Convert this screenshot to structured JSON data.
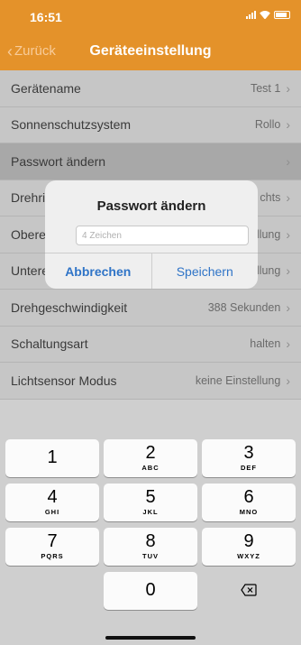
{
  "status": {
    "time": "16:51"
  },
  "nav": {
    "back_label": "Zurück",
    "title": "Geräteeinstellung"
  },
  "settings": [
    {
      "label": "Gerätename",
      "value": "Test 1"
    },
    {
      "label": "Sonnenschutzsystem",
      "value": "Rollo"
    },
    {
      "label": "Passwort ändern",
      "value": ""
    },
    {
      "label": "Drehric",
      "value": "chts"
    },
    {
      "label": "Obere",
      "value": "llung"
    },
    {
      "label": "Untere Endlage",
      "value": "keine Einstellung"
    },
    {
      "label": "Drehgeschwindigkeit",
      "value": "388 Sekunden"
    },
    {
      "label": "Schaltungsart",
      "value": "halten"
    },
    {
      "label": "Lichtsensor Modus",
      "value": "keine Einstellung"
    }
  ],
  "dialog": {
    "title": "Passwort ändern",
    "input_placeholder": "4 Zeichen",
    "input_value": "",
    "cancel_label": "Abbrechen",
    "save_label": "Speichern"
  },
  "keypad": {
    "keys": [
      {
        "digit": "1",
        "letters": ""
      },
      {
        "digit": "2",
        "letters": "ABC"
      },
      {
        "digit": "3",
        "letters": "DEF"
      },
      {
        "digit": "4",
        "letters": "GHI"
      },
      {
        "digit": "5",
        "letters": "JKL"
      },
      {
        "digit": "6",
        "letters": "MNO"
      },
      {
        "digit": "7",
        "letters": "PQRS"
      },
      {
        "digit": "8",
        "letters": "TUV"
      },
      {
        "digit": "9",
        "letters": "WXYZ"
      },
      {
        "digit": "0",
        "letters": ""
      }
    ],
    "delete_icon": "delete-backspace-icon"
  },
  "colors": {
    "accent": "#e4922a",
    "link": "#2f74c7"
  }
}
